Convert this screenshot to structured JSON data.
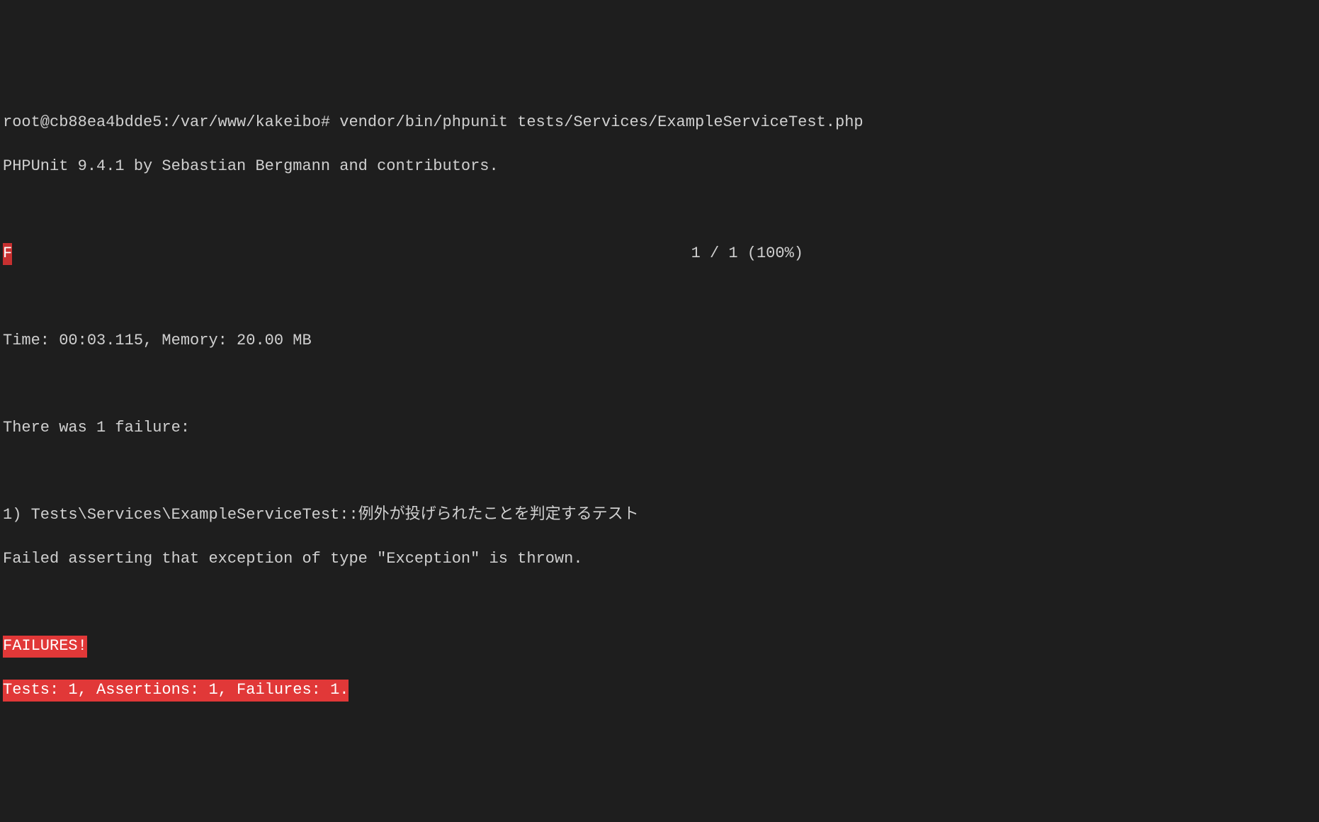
{
  "prompt_line": "root@cb88ea4bdde5:/var/www/kakeibo# vendor/bin/phpunit tests/Services/ExampleServiceTest.php",
  "header": "PHPUnit 9.4.1 by Sebastian Bergmann and contributors.",
  "fail_marker": "F",
  "progress_count": "1 / 1 (100%)",
  "stats": "Time: 00:03.115, Memory: 20.00 MB",
  "failure_header": "There was 1 failure:",
  "failure_name": "1) Tests\\Services\\ExampleServiceTest::例外が投げられたことを判定するテスト",
  "failure_detail": "Failed asserting that exception of type \"Exception\" is thrown.",
  "summary_failures": "FAILURES!",
  "summary_counts": "Tests: 1, Assertions: 1, Failures: 1."
}
